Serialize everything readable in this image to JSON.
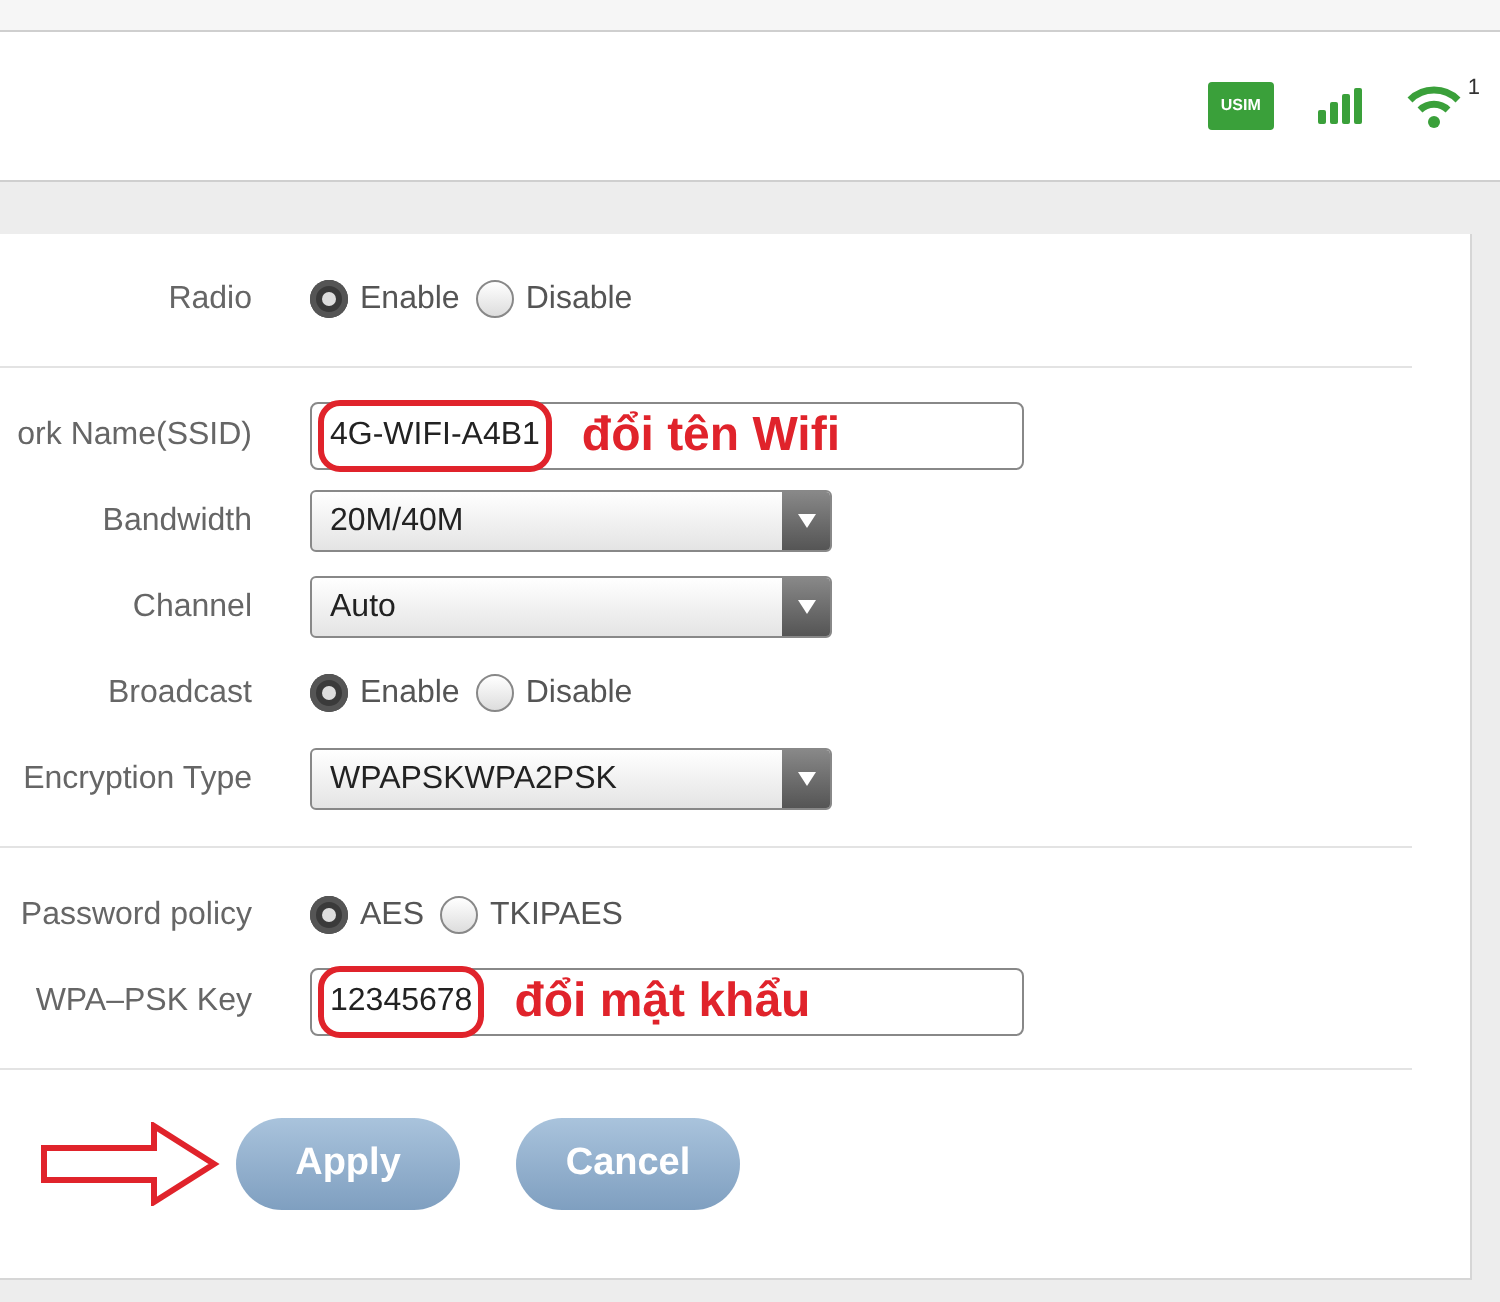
{
  "status_bar": {
    "sim_label": "USIM",
    "wifi_clients": "1"
  },
  "sections": [
    {
      "rows": [
        {
          "kind": "radio",
          "label": "Radio",
          "options": [
            {
              "label": "Enable",
              "selected": true
            },
            {
              "label": "Disable",
              "selected": false
            }
          ]
        }
      ]
    },
    {
      "rows": [
        {
          "kind": "text",
          "label": "ork Name(SSID)",
          "value": "4G-WIFI-A4B1",
          "note": "đổi tên Wifi"
        },
        {
          "kind": "select",
          "label": "Bandwidth",
          "value": "20M/40M"
        },
        {
          "kind": "select",
          "label": "Channel",
          "value": "Auto"
        },
        {
          "kind": "radio",
          "label": "Broadcast",
          "options": [
            {
              "label": "Enable",
              "selected": true
            },
            {
              "label": "Disable",
              "selected": false
            }
          ]
        },
        {
          "kind": "select",
          "label": "Encryption Type",
          "value": "WPAPSKWPA2PSK"
        }
      ]
    },
    {
      "rows": [
        {
          "kind": "radio",
          "label": "Password policy",
          "options": [
            {
              "label": "AES",
              "selected": true
            },
            {
              "label": "TKIPAES",
              "selected": false
            }
          ]
        },
        {
          "kind": "text",
          "label": "WPA–PSK Key",
          "value": "12345678",
          "note": "đổi mật khẩu"
        }
      ]
    }
  ],
  "buttons": [
    {
      "label": "Apply",
      "pointer_arrow": true
    },
    {
      "label": "Cancel",
      "pointer_arrow": false
    }
  ]
}
